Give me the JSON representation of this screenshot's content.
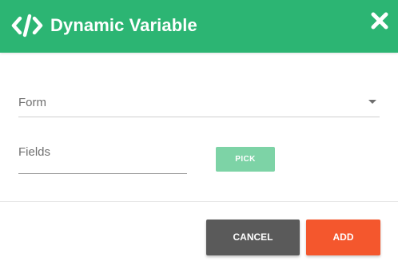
{
  "dialog": {
    "title": "Dynamic Variable",
    "title_icon": "code-icon",
    "close_icon": "close-icon"
  },
  "form_select": {
    "label": "Form",
    "icon": "dropdown-caret-icon"
  },
  "fields_input": {
    "label": "Fields"
  },
  "pick_button": {
    "label": "PICK"
  },
  "footer": {
    "cancel_label": "CANCEL",
    "add_label": "ADD"
  },
  "colors": {
    "header": "#2cb573",
    "pick": "#7dd3a6",
    "cancel": "#5a5a5a",
    "add": "#f4572d"
  }
}
